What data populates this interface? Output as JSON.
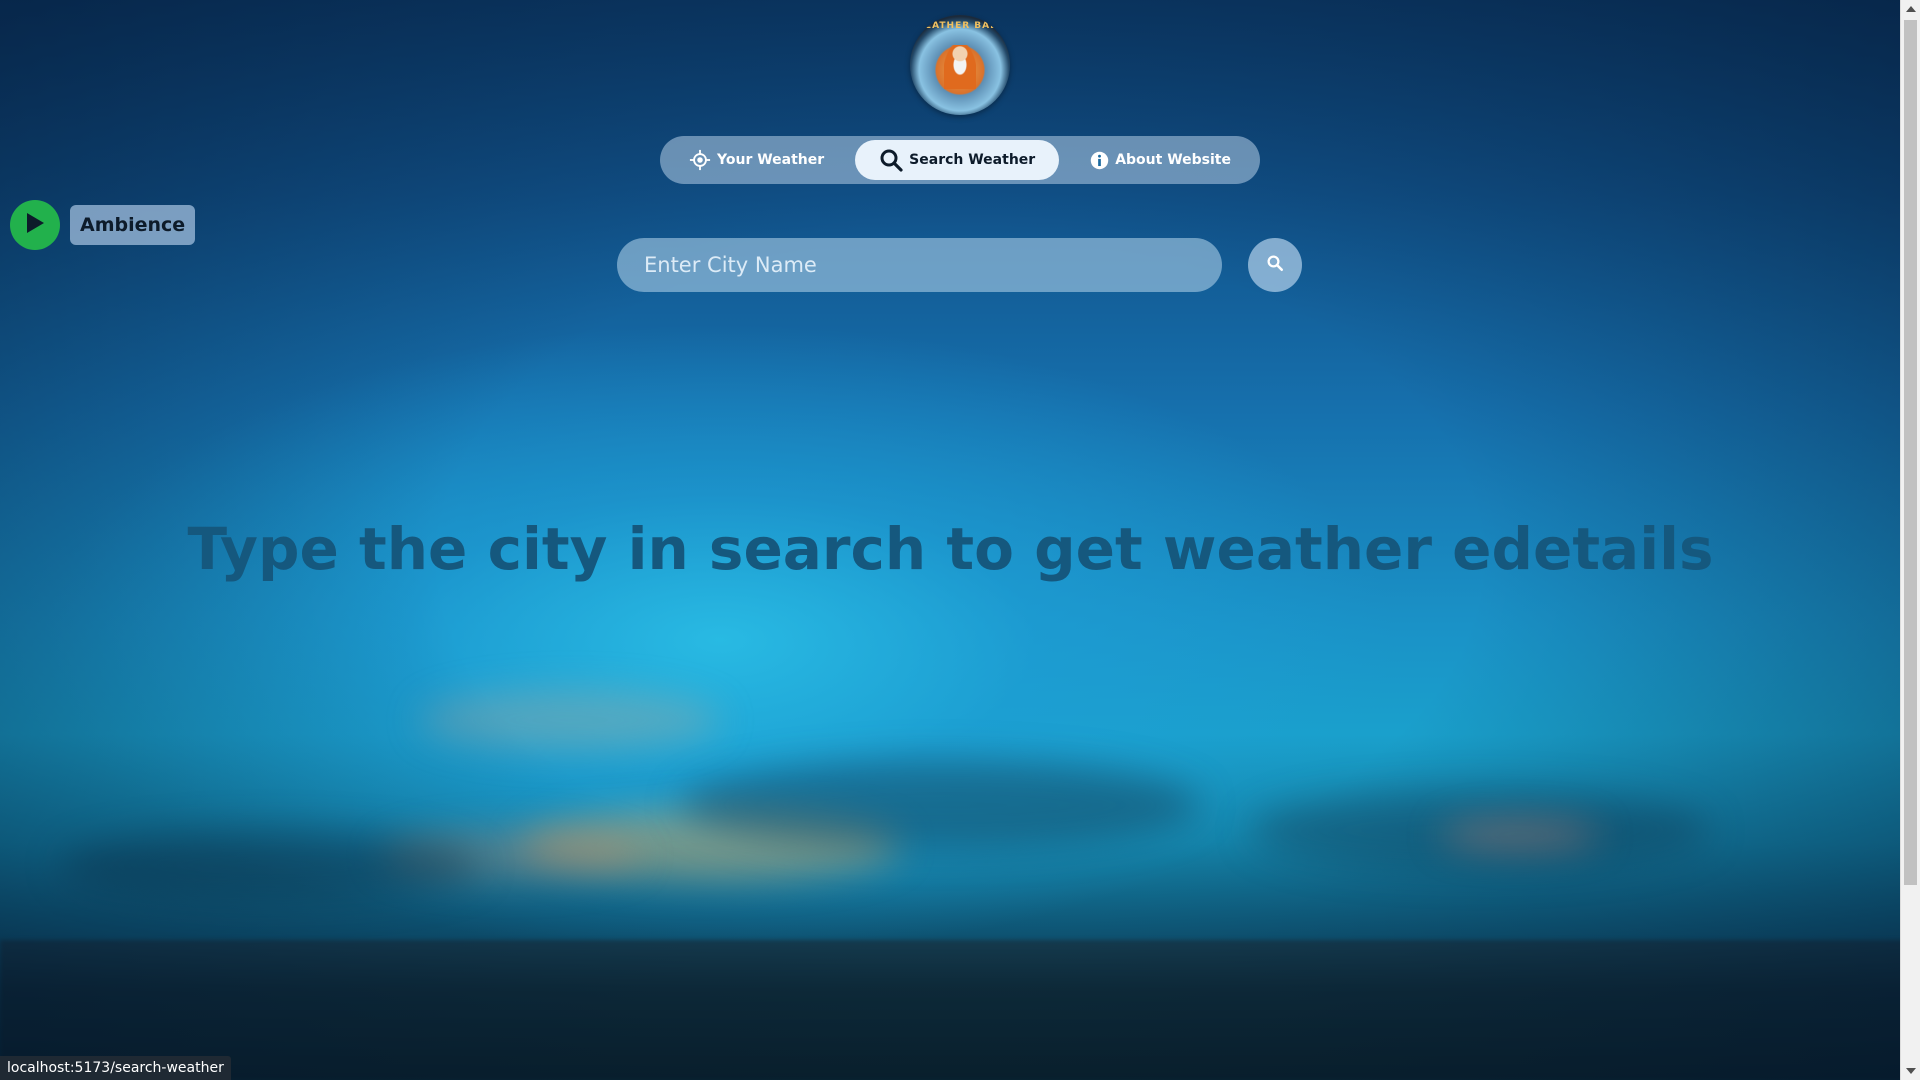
{
  "logo": {
    "ring_text": "WEATHER BABA"
  },
  "nav": {
    "items": [
      {
        "label": "Your Weather",
        "icon": "crosshair-icon",
        "active": false
      },
      {
        "label": "Search Weather",
        "icon": "search-icon",
        "active": true
      },
      {
        "label": "About Website",
        "icon": "info-icon",
        "active": false
      }
    ]
  },
  "ambience": {
    "label": "Ambience",
    "icon": "play-icon"
  },
  "search": {
    "placeholder": "Enter City Name",
    "value": "",
    "button_icon": "search-icon"
  },
  "main": {
    "headline": "Type the city in search to get weather edetails"
  },
  "status": {
    "url": "localhost:5173/search-weather"
  },
  "colors": {
    "accent_green": "#22b14c",
    "active_tab_bg": "#e8f2fb",
    "headline": "#15587e"
  }
}
